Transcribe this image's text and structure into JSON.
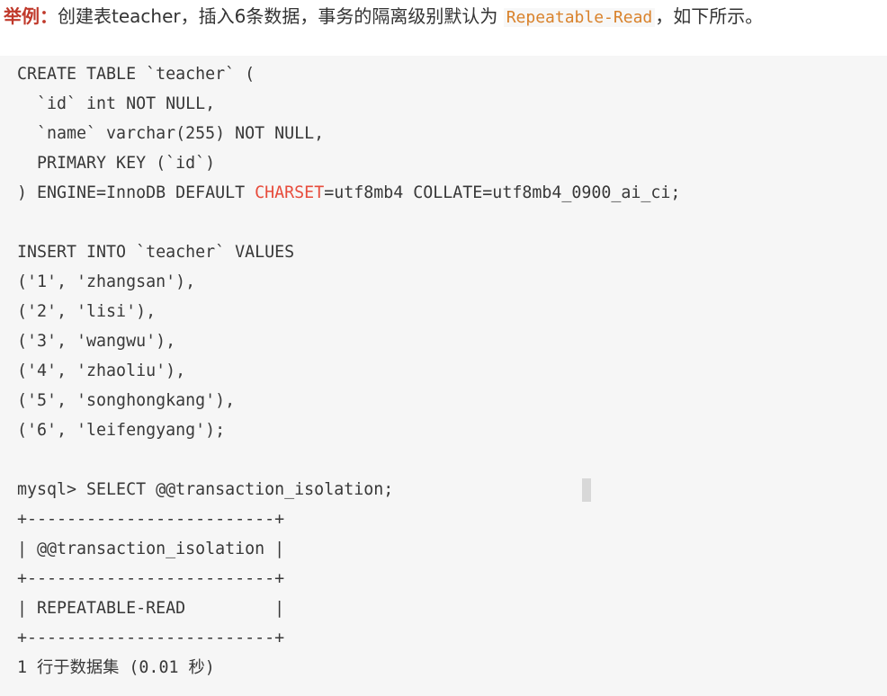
{
  "intro": {
    "label": "举例",
    "colon": "：",
    "text_before": "创建表teacher，插入6条数据，事务的隔离级别默认为 ",
    "isolation_level": "Repeatable-Read",
    "text_after": "，如下所示。"
  },
  "code": {
    "lines": [
      {
        "text": "CREATE TABLE `teacher` ("
      },
      {
        "text": "  `id` int NOT NULL,"
      },
      {
        "text": "  `name` varchar(255) NOT NULL,"
      },
      {
        "text": "  PRIMARY KEY (`id`)"
      },
      {
        "text": ") ENGINE=InnoDB DEFAULT ",
        "highlight": "CHARSET",
        "after": "=utf8mb4 COLLATE=utf8mb4_0900_ai_ci;"
      },
      {
        "text": ""
      },
      {
        "text": "INSERT INTO `teacher` VALUES"
      },
      {
        "text": "('1', 'zhangsan'),"
      },
      {
        "text": "('2', 'lisi'),"
      },
      {
        "text": "('3', 'wangwu'),"
      },
      {
        "text": "('4', 'zhaoliu'),"
      },
      {
        "text": "('5', 'songhongkang'),"
      },
      {
        "text": "('6', 'leifengyang');"
      },
      {
        "text": ""
      },
      {
        "text": "mysql> SELECT @@transaction_isolation;"
      },
      {
        "text": "+-------------------------+"
      },
      {
        "text": "| @@transaction_isolation |"
      },
      {
        "text": "+-------------------------+"
      },
      {
        "text": "| REPEATABLE-READ         |"
      },
      {
        "text": "+-------------------------+"
      },
      {
        "text": "1 行于数据集 (0.01 秒)"
      }
    ]
  }
}
